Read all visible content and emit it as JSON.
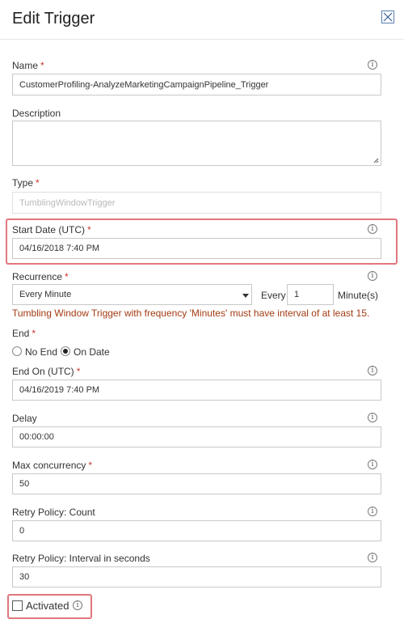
{
  "header": {
    "title": "Edit Trigger",
    "close_icon": "close-x-icon"
  },
  "required_marker": "*",
  "info_glyph": "i",
  "fields": {
    "name": {
      "label": "Name",
      "value": "CustomerProfiling-AnalyzeMarketingCampaignPipeline_Trigger"
    },
    "description": {
      "label": "Description",
      "value": ""
    },
    "type": {
      "label": "Type",
      "value": "TumblingWindowTrigger"
    },
    "start_date": {
      "label": "Start Date (UTC)",
      "value": "04/16/2018 7:40 PM"
    },
    "recurrence": {
      "label": "Recurrence",
      "selected": "Every Minute",
      "every_label": "Every",
      "interval": "1",
      "unit": "Minute(s)",
      "error": "Tumbling Window Trigger with frequency 'Minutes' must have interval of at least 15."
    },
    "end": {
      "label": "End",
      "options": [
        "No End",
        "On Date"
      ],
      "selected": "On Date"
    },
    "end_on": {
      "label": "End On (UTC)",
      "value": "04/16/2019 7:40 PM"
    },
    "delay": {
      "label": "Delay",
      "value": "00:00:00"
    },
    "max_concurrency": {
      "label": "Max concurrency",
      "value": "50"
    },
    "retry_count": {
      "label": "Retry Policy: Count",
      "value": "0"
    },
    "retry_interval": {
      "label": "Retry Policy: Interval in seconds",
      "value": "30"
    },
    "activated": {
      "label": "Activated",
      "checked": false
    }
  },
  "colors": {
    "required": "#c8392f",
    "error_text": "#a33b13",
    "highlight_border": "#e0777e",
    "close_border": "#5a7db0"
  }
}
